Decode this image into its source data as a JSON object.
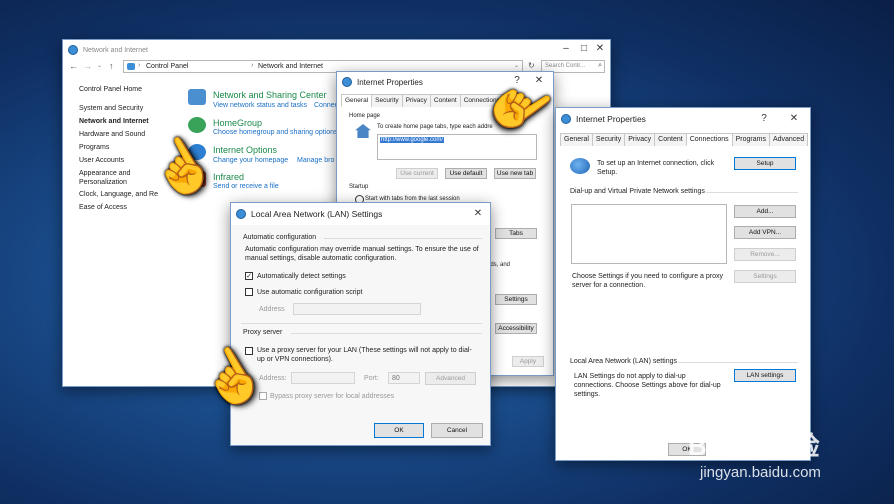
{
  "control_panel": {
    "title": "Network and Internet",
    "breadcrumb": [
      "Control Panel",
      "Network and Internet"
    ],
    "search_placeholder": "Search Contr...",
    "sidebar": [
      "Control Panel Home",
      "System and Security",
      "Network and Internet",
      "Hardware and Sound",
      "Programs",
      "User Accounts",
      "Appearance and",
      "Personalization",
      "Clock, Language, and Re",
      "Ease of Access"
    ],
    "sections": [
      {
        "title": "Network and Sharing Center",
        "links": [
          "View network status and tasks",
          "Connect"
        ]
      },
      {
        "title": "HomeGroup",
        "links": [
          "Choose homegroup and sharing options"
        ]
      },
      {
        "title": "Internet Options",
        "links": [
          "Change your homepage",
          "Manage bro"
        ]
      },
      {
        "title": "Infrared",
        "links": [
          "Send or receive a file"
        ]
      }
    ]
  },
  "inet_back": {
    "title": "Internet Properties",
    "tabs": [
      "General",
      "Security",
      "Privacy",
      "Content",
      "Connections",
      "Pro"
    ],
    "home_page_label": "Home page",
    "home_page_desc": "To create home page tabs, type each addre",
    "url": "http://www.google.com/",
    "buttons": {
      "use_current": "Use current",
      "use_default": "Use default",
      "use_new_tab": "Use new tab",
      "tabs": "Tabs",
      "settings": "Settings",
      "accessibility": "Accessibility",
      "apply": "Apply"
    },
    "startup_label": "Startup",
    "startup_option": "Start with tabs from the last session",
    "partial_text": "ords, and"
  },
  "lan": {
    "title": "Local Area Network (LAN) Settings",
    "auto_config_label": "Automatic configuration",
    "auto_config_desc": "Automatic configuration may override manual settings.  To ensure the use of manual settings, disable automatic configuration.",
    "auto_detect": "Automatically detect settings",
    "auto_detect_checked": true,
    "use_script": "Use automatic configuration script",
    "address_label": "Address",
    "proxy_label": "Proxy server",
    "use_proxy": "Use a proxy server for your LAN (These settings will not apply to dial-up or VPN connections).",
    "proxy_address_label": "Address:",
    "port_label": "Port:",
    "port_value": "80",
    "advanced": "Advanced",
    "bypass": "Bypass proxy server for local addresses",
    "ok": "OK",
    "cancel": "Cancel"
  },
  "inet_front": {
    "title": "Internet Properties",
    "tabs": [
      "General",
      "Security",
      "Privacy",
      "Content",
      "Connections",
      "Programs",
      "Advanced"
    ],
    "setup_desc": "To set up an Internet connection, click Setup.",
    "setup": "Setup",
    "dialup_label": "Dial-up and Virtual Private Network settings",
    "add": "Add...",
    "add_vpn": "Add VPN...",
    "remove": "Remove...",
    "settings": "Settings",
    "choose_settings": "Choose Settings if you need to configure a proxy server for a connection.",
    "lan_label": "Local Area Network (LAN) settings",
    "lan_desc": "LAN Settings do not apply to dial-up connections. Choose Settings above for dial-up settings.",
    "lan_settings": "LAN settings",
    "ok": "OK"
  },
  "watermark": {
    "brand": "Baidu 经验",
    "url": "jingyan.baidu.com"
  }
}
